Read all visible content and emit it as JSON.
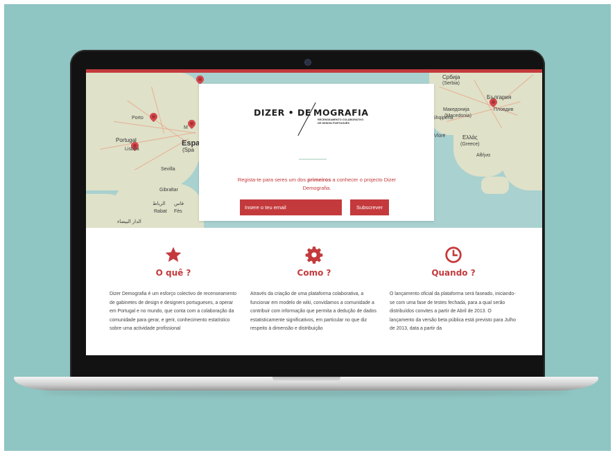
{
  "map_labels": {
    "portugal": "Portugal",
    "lisboa": "Lisboa",
    "porto": "Porto",
    "espana": "Espa",
    "spain": "(Spa",
    "madrid": "M",
    "sevilla": "Sevilla",
    "gibraltar": "Gibraltar",
    "rabat": "الرباط",
    "rabat_lat": "Rabat",
    "fes": "فاس",
    "fes_lat": "Fès",
    "casablanca": "الدار البيضاء",
    "srbija": "Србија",
    "serbia": "(Serbia)",
    "bulgaria": "България",
    "makedonija": "Македонија",
    "makedonija_sub": "(Macedonia)",
    "shqiperia": "Shqipëria",
    "ellas": "Ελλάς",
    "greece": "(Greece)",
    "athina": "Αθήνα",
    "plovdiv": "Пловдив",
    "vlore": "Vlorë",
    "bo": "Bo"
  },
  "card": {
    "logo_left": "DIZER • DE",
    "logo_right": "MOGRAFIA",
    "logo_sub": "RECENSEAMENTO COLABORATIVO DE DESIGN PORTUGUÊS",
    "invite_pre": "Regista-te para seres um dos ",
    "invite_bold": "primeiros",
    "invite_post": " a conhecer o projecto Dizer Demografia.",
    "email_placeholder": "Insere o teu email",
    "subscribe_label": "Subscrever"
  },
  "columns": [
    {
      "icon": "star-icon",
      "title": "O quê ?",
      "text": "Dizer Demografia é um esforço colectivo de recenseamento de gabinetes de design e designers portugueses, a operar em Portugal e no mundo, que conta com a colaboração da comunidade para gerar, e gerir, conhecimento estatístico sobre uma actividade profissional"
    },
    {
      "icon": "gear-icon",
      "title": "Como ?",
      "text": "Através da criação de uma plataforma colaborativa, a funcionar em modelo de wiki, convidamos a comunidade a contribuir com informação que permita a dedução de dados estatisticamente significativos, em particular no que diz respeito à dimensão e distribuição"
    },
    {
      "icon": "clock-icon",
      "title": "Quando ?",
      "text": "O lançamento oficial da plataforma será faseado, iniciando-se com uma fase de testes fechada, para a qual serão distribuídos convites a partir de Abril de 2013. O lançamento da versão beta pública está previsto para Julho de 2013, data a partir da"
    }
  ],
  "colors": {
    "accent": "#c43a3c",
    "background": "#8fc5c2",
    "map_sea": "#a9d1cf",
    "map_land": "#dfe1c8"
  }
}
